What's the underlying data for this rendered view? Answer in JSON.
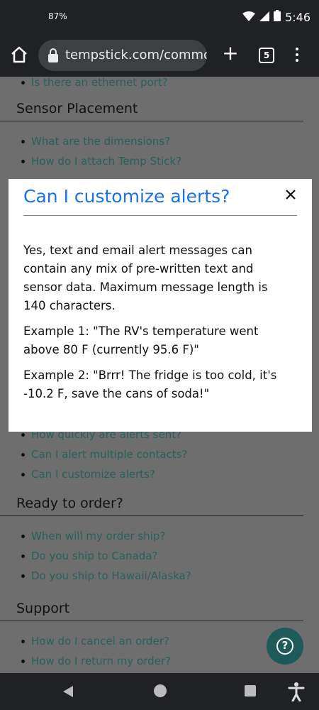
{
  "status_bar": {
    "battery_text": "87%",
    "time": "5:46"
  },
  "browser": {
    "url": "tempstick.com/common",
    "tab_count": "5"
  },
  "page": {
    "top_item": "Is there an ethernet port?",
    "sections": [
      {
        "heading": "Sensor Placement",
        "items": [
          "What are the dimensions?",
          "How do I attach Temp Stick?"
        ]
      }
    ],
    "alerts_items": [
      "How quickly are alerts sent?",
      "Can I alert multiple contacts?",
      "Can I customize alerts?"
    ],
    "ready": {
      "heading": "Ready to order?",
      "items": [
        "When will my order ship?",
        "Do you ship to Canada?",
        "Do you ship to Hawaii/Alaska?"
      ]
    },
    "support": {
      "heading": "Support",
      "items": [
        "How do I cancel an order?",
        "How do I return my order?"
      ]
    }
  },
  "modal": {
    "title": "Can I customize alerts?",
    "paragraphs": [
      "Yes, text and email alert messages can contain any mix of pre-written text and sensor data. Maximum message length is 140 characters.",
      "Example 1: \"The RV's temperature went above 80 F (currently 95.6 F)\"",
      "Example 2: \"Brrr! The fridge is too cold, it's -10.2 F, save the cans of soda!\""
    ]
  },
  "help_fab": {
    "symbol": "?"
  },
  "colors": {
    "link": "#2b5f5c",
    "title_blue": "#1a73e8",
    "overlay": "#6e6e6e",
    "fab": "#1e5a5a"
  }
}
